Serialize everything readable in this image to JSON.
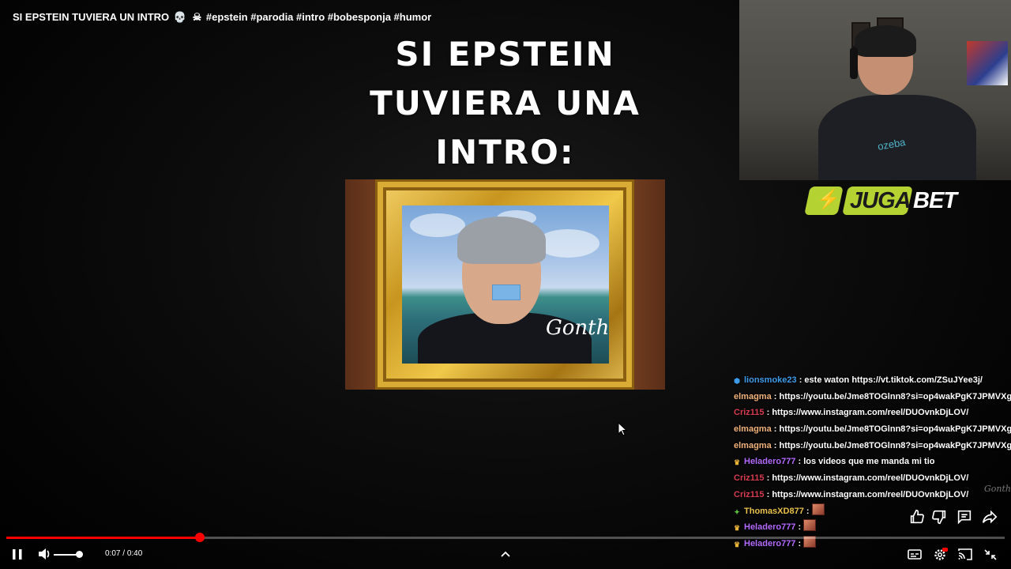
{
  "video": {
    "title": "SI EPSTEIN TUVIERA UN INTRO",
    "title_hashtags": "#epstein #parodia #intro #bobesponja #humor",
    "meme_text_line1": "SI EPSTEIN",
    "meme_text_line2": "TUVIERA UNA",
    "meme_text_line3": "INTRO:",
    "signature": "Gonth",
    "watermark": "Gonth"
  },
  "sponsor": {
    "brand_part1": "JUGA",
    "brand_part2": "BET",
    "brand_color": "#b4d333"
  },
  "webcam": {
    "shirt_text": "ozeba"
  },
  "chat": {
    "messages": [
      {
        "user": "lionsmoke23",
        "color": "#3d9be9",
        "badge": "cube-icon",
        "text": ": este waton https://vt.tiktok.com/ZSuJYee3j/"
      },
      {
        "user": "elmagma",
        "color": "#f0b27a",
        "badge": "",
        "text": ": https://youtu.be/Jme8TOGlnn8?si=op4wakPgK7JPMVXg"
      },
      {
        "user": "Criz115",
        "color": "#d63c50",
        "badge": "",
        "text": ": https://www.instagram.com/reel/DUOvnkDjLOV/"
      },
      {
        "user": "elmagma",
        "color": "#f0b27a",
        "badge": "",
        "text": ": https://youtu.be/Jme8TOGlnn8?si=op4wakPgK7JPMVXg"
      },
      {
        "user": "elmagma",
        "color": "#f0b27a",
        "badge": "",
        "text": ": https://youtu.be/Jme8TOGlnn8?si=op4wakPgK7JPMVXg"
      },
      {
        "user": "Heladero777",
        "color": "#b36bff",
        "badge": "crown-icon",
        "text": ": los videos que me manda mi tio"
      },
      {
        "user": "Criz115",
        "color": "#d63c50",
        "badge": "",
        "text": ": https://www.instagram.com/reel/DUOvnkDjLOV/"
      },
      {
        "user": "Criz115",
        "color": "#d63c50",
        "badge": "",
        "text": ": https://www.instagram.com/reel/DUOvnkDjLOV/"
      },
      {
        "user": "ThomasXD877",
        "color": "#e8c04a",
        "badge": "diamond-icon",
        "text": ":",
        "emote": true
      },
      {
        "user": "Heladero777",
        "color": "#b36bff",
        "badge": "crown-icon",
        "text": ":",
        "emote": true
      },
      {
        "user": "Heladero777",
        "color": "#b36bff",
        "badge": "crown-icon",
        "text": ":",
        "emote": true
      }
    ]
  },
  "player": {
    "current_time": "0:07",
    "duration": "0:40",
    "time_separator": " / ",
    "progress_fraction": 0.1935,
    "volume_fraction": 0.85,
    "accent_color": "#ff0000",
    "controls": {
      "play_pause": "pause-icon",
      "volume": "volume-icon",
      "expand": "chevron-up-icon",
      "captions": "captions-icon",
      "settings": "gear-icon",
      "cast": "cast-icon",
      "exit_fullscreen": "exit-fullscreen-icon"
    },
    "side_actions": [
      "like-icon",
      "dislike-icon",
      "comment-icon",
      "share-icon"
    ]
  }
}
